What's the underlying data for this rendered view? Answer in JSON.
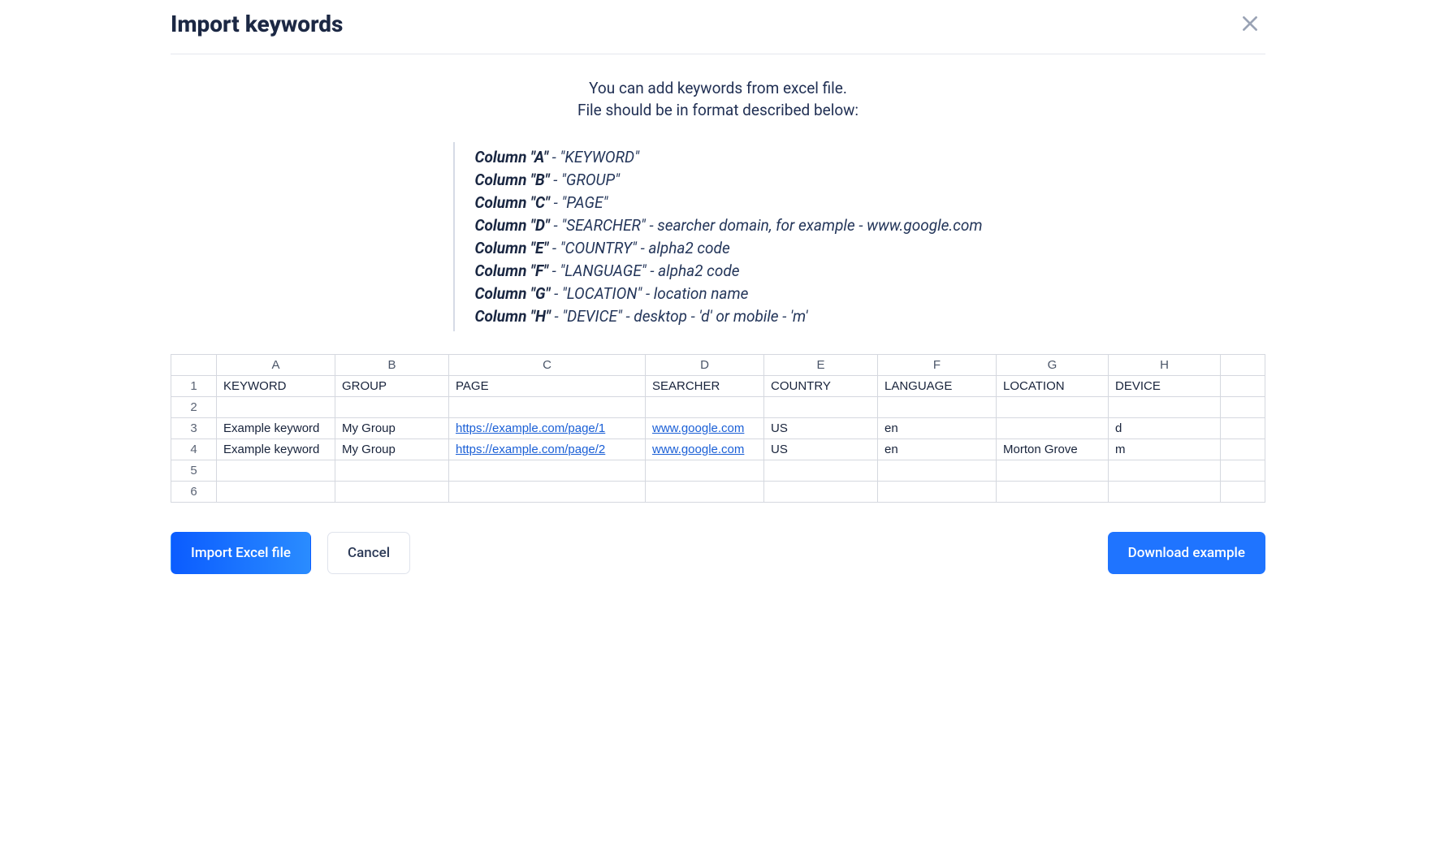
{
  "header": {
    "title": "Import keywords"
  },
  "intro": {
    "line1": "You can add keywords from excel file.",
    "line2": "File should be in format described below:"
  },
  "columns": [
    {
      "label": "Column \"A\"",
      "desc": "\"KEYWORD\""
    },
    {
      "label": "Column \"B\"",
      "desc": "\"GROUP\""
    },
    {
      "label": "Column \"C\"",
      "desc": "\"PAGE\""
    },
    {
      "label": "Column \"D\"",
      "desc": "\"SEARCHER\" - searcher domain, for example - www.google.com"
    },
    {
      "label": "Column \"E\"",
      "desc": "\"COUNTRY\" - alpha2 code"
    },
    {
      "label": "Column \"F\"",
      "desc": "\"LANGUAGE\" - alpha2 code"
    },
    {
      "label": "Column \"G\"",
      "desc": "\"LOCATION\" - location name"
    },
    {
      "label": "Column \"H\"",
      "desc": "\"DEVICE\" - desktop - 'd' or mobile - 'm'"
    }
  ],
  "sheet": {
    "col_letters": [
      "A",
      "B",
      "C",
      "D",
      "E",
      "F",
      "G",
      "H"
    ],
    "row_numbers": [
      "1",
      "2",
      "3",
      "4",
      "5",
      "6"
    ],
    "header_row": [
      "KEYWORD",
      "GROUP",
      "PAGE",
      "SEARCHER",
      "COUNTRY",
      "LANGUAGE",
      "LOCATION",
      "DEVICE"
    ],
    "rows": [
      [
        "Example keyword",
        "My Group",
        "https://example.com/page/1",
        "www.google.com",
        "US",
        "en",
        "",
        "d"
      ],
      [
        "Example keyword",
        "My Group",
        "https://example.com/page/2",
        "www.google.com",
        "US",
        "en",
        "Morton Grove",
        "m"
      ]
    ],
    "link_columns": [
      2,
      3
    ]
  },
  "buttons": {
    "import": "Import Excel file",
    "cancel": "Cancel",
    "download": "Download example"
  }
}
